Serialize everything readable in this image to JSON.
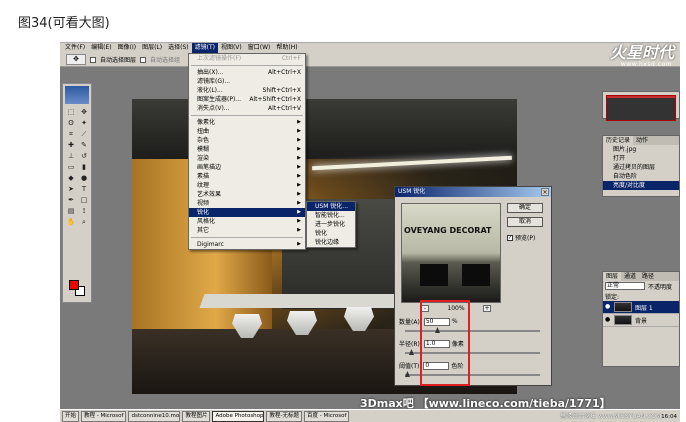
{
  "caption": "图34(可看大图)",
  "menubar": [
    "文件(F)",
    "编辑(E)",
    "图像(I)",
    "图层(L)",
    "选择(S)",
    "滤镜(T)",
    "视图(V)",
    "窗口(W)",
    "帮助(H)"
  ],
  "options": {
    "auto_select": "自动选择图层",
    "auto_select_group": "自动选择组"
  },
  "logo": {
    "text": "火星时代",
    "sub": "www.hxsd.com"
  },
  "filter_menu": {
    "top": [
      {
        "label": "上次滤镜操作(F)",
        "key": "Ctrl+F",
        "disabled": true
      },
      {
        "label": "抽出(X)...",
        "key": "Alt+Ctrl+X"
      },
      {
        "label": "滤镜库(G)...",
        "key": ""
      },
      {
        "label": "液化(L)...",
        "key": "Shift+Ctrl+X"
      },
      {
        "label": "图案生成器(P)...",
        "key": "Alt+Shift+Ctrl+X"
      },
      {
        "label": "消失点(V)...",
        "key": "Alt+Ctrl+V"
      }
    ],
    "groups": [
      "像素化",
      "扭曲",
      "杂色",
      "模糊",
      "渲染",
      "画笔描边",
      "素描",
      "纹理",
      "艺术效果",
      "视频",
      "锐化",
      "风格化",
      "其它"
    ],
    "selected": "锐化",
    "last": "Digimarc"
  },
  "sharpen_submenu": [
    "USM 锐化...",
    "智能锐化...",
    "进一步锐化",
    "锐化",
    "锐化边缘"
  ],
  "dialog": {
    "title": "USM 锐化",
    "ok": "确定",
    "cancel": "取消",
    "preview": "预览(P)",
    "zoom": "100%",
    "preview_text": "OVEYANG DECORAT",
    "amount_label": "数量(A):",
    "amount_value": "50",
    "amount_unit": "%",
    "radius_label": "半径(R):",
    "radius_value": "1.0",
    "radius_unit": "像素",
    "threshold_label": "阈值(T):",
    "threshold_value": "0",
    "threshold_unit": "色阶"
  },
  "history_panel": {
    "tabs": [
      "历史记录",
      "动作"
    ],
    "file": "图片.jpg",
    "items": [
      "打开",
      "通过拷贝的图层",
      "自动色阶",
      "亮度/对比度"
    ]
  },
  "layers_panel": {
    "tabs": [
      "图层",
      "通道",
      "路径"
    ],
    "mode": "正常",
    "opacity_label": "不透明度",
    "lock_label": "锁定:",
    "layers": [
      "图层 1",
      "背景"
    ]
  },
  "taskbar": [
    "开始",
    "教程 - Microsof",
    "dstconnine10.mo",
    "教程图片",
    "Adobe Photoshop",
    "教程-无标题",
    "百度 - Microsof"
  ],
  "clock": "16:04",
  "watermark": "3Dmax吧 【www.lineco.com/tieba/1771】",
  "watermark2": "思缘设计论坛 www.MISSYUAN.COM"
}
